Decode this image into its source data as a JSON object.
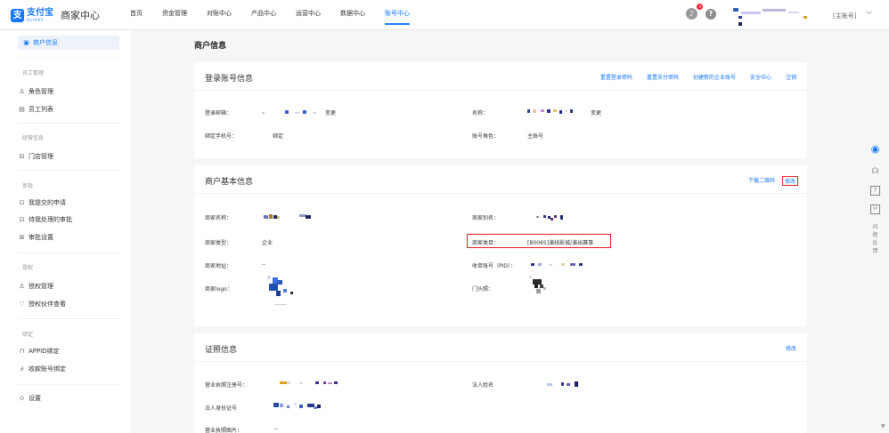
{
  "header": {
    "logo_mark": "支",
    "logo_cn": "支付宝",
    "logo_en": "ALIPAY",
    "logo_sub": "商家中心",
    "nav": [
      "首页",
      "资金管理",
      "对账中心",
      "产品中心",
      "运营中心",
      "数据中心",
      "账号中心"
    ],
    "active_nav": "账号中心",
    "notification_badge": "9",
    "help_icon": "?",
    "account_label": "[主账号]",
    "account_icon": "chevron-down-icon"
  },
  "sidebar": {
    "active_item": "商户信息",
    "groups": [
      {
        "title": "",
        "items": [
          {
            "label": "商户信息",
            "icon": "id-card-icon"
          }
        ]
      },
      {
        "title": "员工管理",
        "items": [
          {
            "label": "角色管理",
            "icon": "user-icon"
          },
          {
            "label": "员工列表",
            "icon": "list-icon"
          }
        ]
      },
      {
        "title": "经营信息",
        "items": [
          {
            "label": "门店管理",
            "icon": "store-icon"
          }
        ]
      },
      {
        "title": "审批",
        "items": [
          {
            "label": "我提交的申请",
            "icon": "inbox-icon"
          },
          {
            "label": "待我处理的审批",
            "icon": "inbox-icon"
          },
          {
            "label": "审批设置",
            "icon": "settings-box-icon"
          }
        ]
      },
      {
        "title": "授权",
        "items": [
          {
            "label": "授权管理",
            "icon": "user-icon"
          },
          {
            "label": "授权伙伴查看",
            "icon": "heart-icon"
          }
        ]
      },
      {
        "title": "绑定",
        "items": [
          {
            "label": "APPID绑定",
            "icon": "lock-icon"
          },
          {
            "label": "收款账号绑定",
            "icon": "link-icon"
          }
        ]
      },
      {
        "title": "",
        "items": [
          {
            "label": "设置",
            "icon": "gear-icon"
          }
        ]
      }
    ]
  },
  "page_title": "商户信息",
  "login_card": {
    "title": "登录账号信息",
    "actions": [
      "重置登录密码",
      "重置支付密码",
      "创建新的企业账号",
      "安全中心",
      "注销"
    ],
    "email_label": "登录邮箱：",
    "email_change": "变更",
    "name_label": "名称：",
    "name_change": "变更",
    "phone_label": "绑定手机号：",
    "phone_bind": "绑定",
    "role_label": "账号角色：",
    "role_value": "主账号"
  },
  "basic_card": {
    "title": "商户基本信息",
    "actions": [
      "下载二维码",
      "修改"
    ],
    "name_label": "商家名称：",
    "alias_label": "商家别名：",
    "type_label": "商家类型：",
    "type_value": "企业",
    "category_label": "商家类目：",
    "category_value": "[B0065]演线影城/演出赛事",
    "address_label": "商家地址：",
    "address_value": "--",
    "pid_label": "收单账号（PID）：",
    "logo_label": "商家logo：",
    "door_label": "门头照："
  },
  "license_card": {
    "title": "证照信息",
    "action": "修改",
    "reg_label": "营业执照注册号：",
    "legal_name_label": "法人姓名",
    "legal_id_label": "法人身份证号",
    "license_img_label": "营业执照图片：",
    "license_img_value": "--"
  },
  "right_toolbar": {
    "text_button": "问题反馈",
    "icons": [
      "assistant-robot-icon",
      "headset-icon",
      "question-box-icon",
      "mail-icon"
    ]
  },
  "colors": {
    "primary": "#1677ff",
    "highlight": "#e02020",
    "bg": "#f5f6f8"
  }
}
